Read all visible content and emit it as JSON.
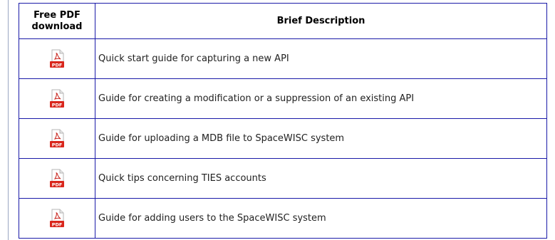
{
  "table": {
    "header": {
      "col1": "Free PDF download",
      "col2": "Brief Description"
    },
    "rows": [
      {
        "icon": "pdf-icon",
        "icon_label": "PDF",
        "description": "Quick start guide for capturing a new API"
      },
      {
        "icon": "pdf-icon",
        "icon_label": "PDF",
        "description": "Guide for creating a modification or a suppression of an existing API"
      },
      {
        "icon": "pdf-icon",
        "icon_label": "PDF",
        "description": "Guide for uploading a MDB file to SpaceWISC system"
      },
      {
        "icon": "pdf-icon",
        "icon_label": "PDF",
        "description": "Quick tips concerning TIES accounts"
      },
      {
        "icon": "pdf-icon",
        "icon_label": "PDF",
        "description": "Guide for adding users to the SpaceWISC system"
      }
    ]
  },
  "colors": {
    "border": "#1a1aa8",
    "pdf_badge": "#d9261c"
  }
}
